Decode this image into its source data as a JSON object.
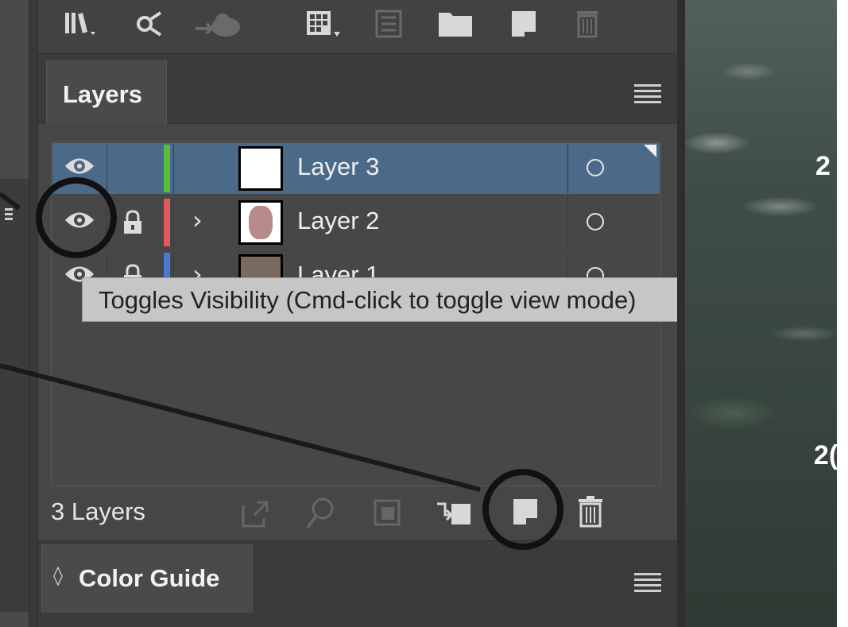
{
  "toolbar": {
    "icons": [
      "libraries-icon",
      "links-icon",
      "cloud-sync-icon",
      "grid-icon",
      "list-icon",
      "folder-icon",
      "new-page-icon",
      "trash-icon"
    ]
  },
  "layers_panel": {
    "tab_label": "Layers",
    "layers": [
      {
        "name": "Layer 3",
        "color": "#58c038",
        "selected": true,
        "locked": false,
        "expandable": false,
        "visible": true
      },
      {
        "name": "Layer 2",
        "color": "#e35a5a",
        "selected": false,
        "locked": true,
        "expandable": true,
        "visible": true
      },
      {
        "name": "Layer 1",
        "color": "#4a78d8",
        "selected": false,
        "locked": true,
        "expandable": true,
        "visible": true
      }
    ],
    "footer": {
      "layer_count": "3 Layers",
      "icons": [
        "export-icon",
        "locate-object-icon",
        "clipping-mask-icon",
        "sublayer-icon",
        "new-layer-icon",
        "trash-icon"
      ]
    }
  },
  "tooltip": {
    "text": "Toggles Visibility (Cmd-click to toggle view mode)"
  },
  "color_guide": {
    "tab_label": "Color Guide",
    "updown_glyph": "◊"
  },
  "canvas": {
    "labels": [
      "2",
      "2("
    ]
  },
  "colors": {
    "panel_bg": "#464646",
    "selected_row": "#4b6a8a",
    "tooltip_bg": "#c6c6c6",
    "annotation": "#111111"
  }
}
